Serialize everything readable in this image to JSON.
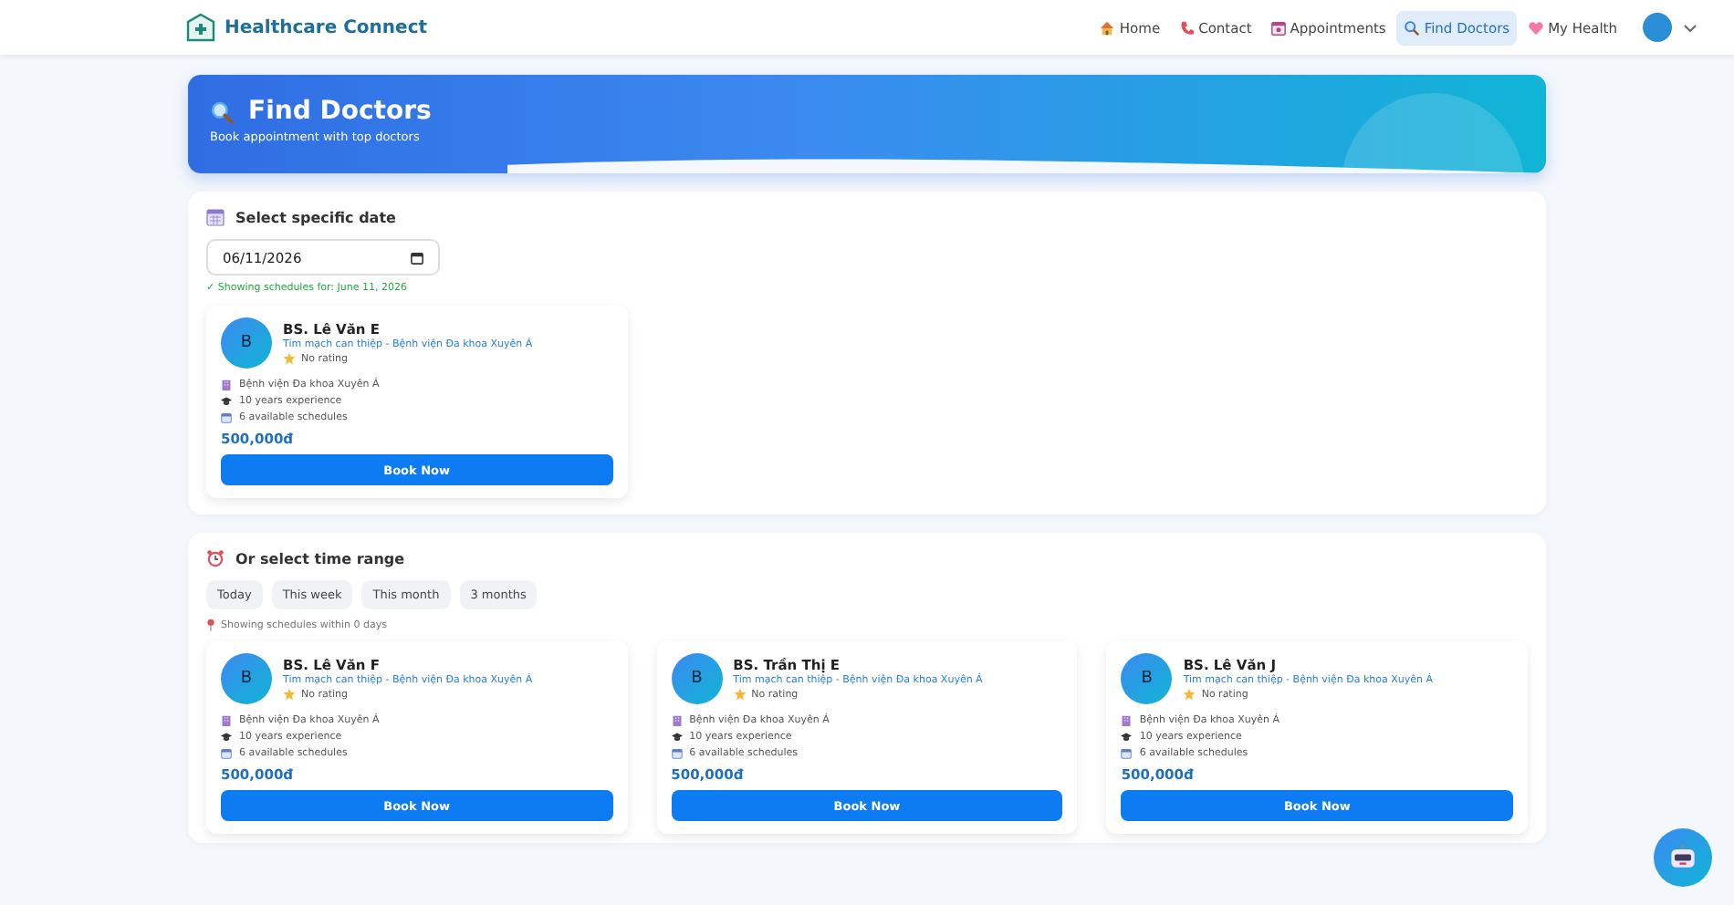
{
  "brand": {
    "name": "Healthcare Connect"
  },
  "nav": [
    {
      "label": "Home",
      "selected": false
    },
    {
      "label": "Contact",
      "selected": false
    },
    {
      "label": "Appointments",
      "selected": false
    },
    {
      "label": "Find Doctors",
      "selected": true
    },
    {
      "label": "My Health",
      "selected": false
    }
  ],
  "banner": {
    "title": "Find Doctors",
    "subtitle": "Book appointment with top doctors"
  },
  "date_section": {
    "title": "Select specific date",
    "date_value": "06/11/2026",
    "status": "✓ Showing schedules for: June 11, 2026",
    "doctors": [
      {
        "initial": "B",
        "name": "BS. Lê Văn E",
        "specialty": "Tim mạch can thiệp - Bệnh viện Đa khoa Xuyên Á",
        "rating": "No rating",
        "hospital": "Bệnh viện Đa khoa Xuyên Á",
        "experience": "10 years experience",
        "schedules": "6 available schedules",
        "price": "500,000đ",
        "button": "Book Now"
      }
    ]
  },
  "range_section": {
    "title": "Or select time range",
    "ranges": [
      {
        "label": "Today",
        "selected": false
      },
      {
        "label": "This week",
        "selected": false
      },
      {
        "label": "This month",
        "selected": false
      },
      {
        "label": "3 months",
        "selected": false
      }
    ],
    "status": "Showing schedules within 0 days",
    "doctors": [
      {
        "initial": "B",
        "name": "BS. Lê Văn F",
        "specialty": "Tim mạch can thiệp - Bệnh viện Đa khoa Xuyên Á",
        "rating": "No rating",
        "hospital": "Bệnh viện Đa khoa Xuyên Á",
        "experience": "10 years experience",
        "schedules": "6 available schedules",
        "price": "500,000đ",
        "button": "Book Now"
      },
      {
        "initial": "B",
        "name": "BS. Trần Thị E",
        "specialty": "Tim mạch can thiệp - Bệnh viện Đa khoa Xuyên Á",
        "rating": "No rating",
        "hospital": "Bệnh viện Đa khoa Xuyên Á",
        "experience": "10 years experience",
        "schedules": "6 available schedules",
        "price": "500,000đ",
        "button": "Book Now"
      },
      {
        "initial": "B",
        "name": "BS. Lê Văn J",
        "specialty": "Tim mạch can thiệp - Bệnh viện Đa khoa Xuyên Á",
        "rating": "No rating",
        "hospital": "Bệnh viện Đa khoa Xuyên Á",
        "experience": "10 years experience",
        "schedules": "6 available schedules",
        "price": "500,000đ",
        "button": "Book Now"
      }
    ]
  }
}
